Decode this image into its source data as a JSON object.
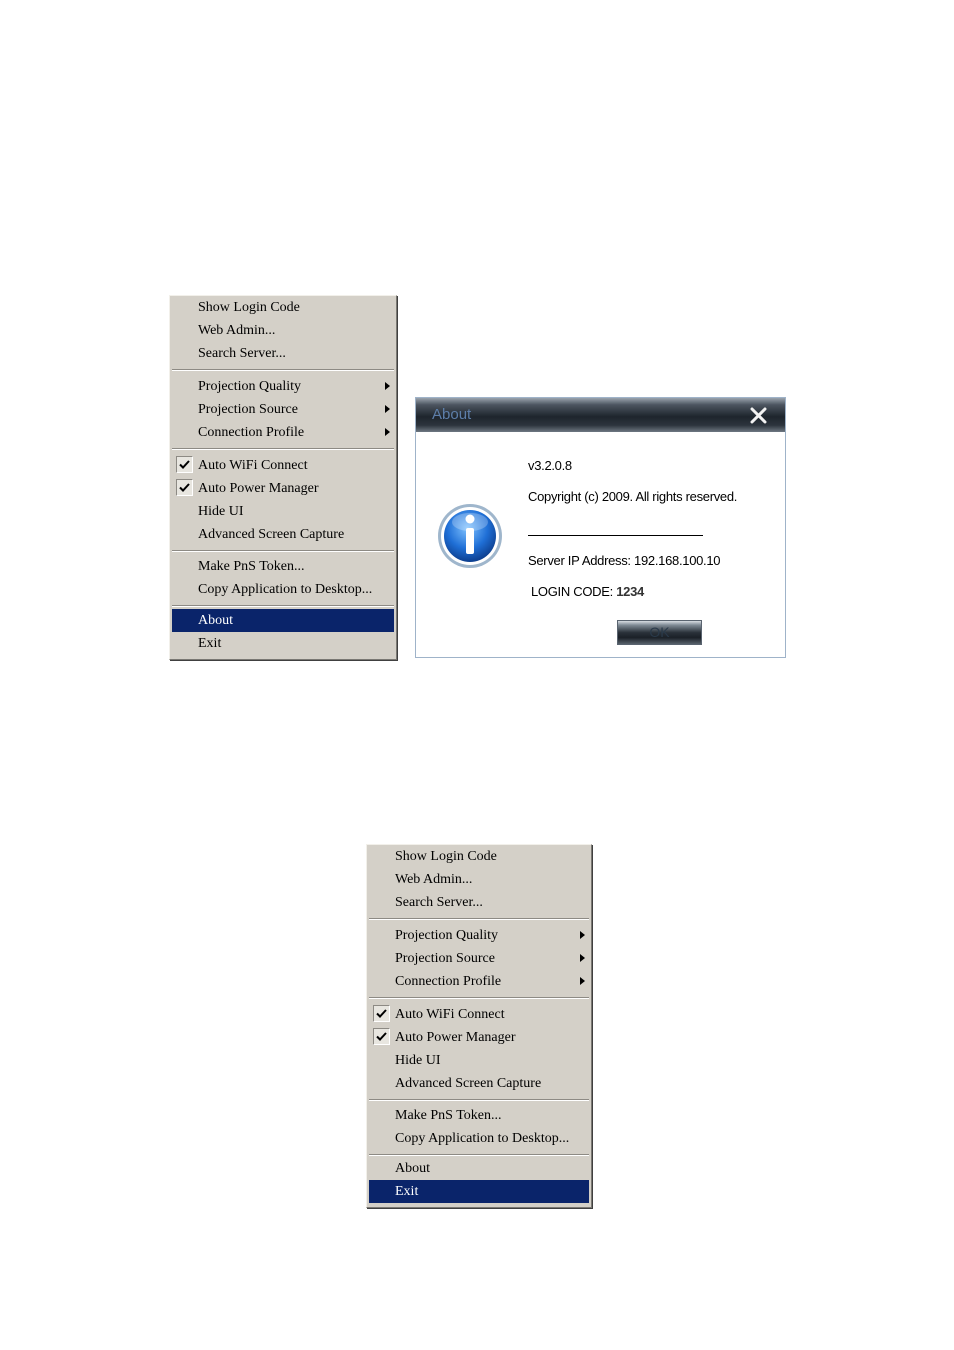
{
  "menu_top": {
    "items": [
      {
        "label": "Show Login Code"
      },
      {
        "label": "Web Admin..."
      },
      {
        "label": "Search Server..."
      },
      {
        "label": "Projection Quality"
      },
      {
        "label": "Projection Source"
      },
      {
        "label": "Connection Profile"
      },
      {
        "label": "Auto WiFi Connect",
        "checked": true
      },
      {
        "label": "Auto Power Manager",
        "checked": true
      },
      {
        "label": "Hide UI"
      },
      {
        "label": "Advanced Screen Capture"
      },
      {
        "label": "Make PnS Token..."
      },
      {
        "label": "Copy Application to Desktop..."
      },
      {
        "label": "About",
        "highlighted": true
      },
      {
        "label": "Exit"
      }
    ]
  },
  "about_dialog": {
    "title": "About",
    "version": "v3.2.0.8",
    "copyright": "Copyright (c) 2009. All rights reserved.",
    "server_ip": "Server IP Address: 192.168.100.10",
    "login_code_label": "LOGIN CODE: ",
    "login_code_value": "1234",
    "ok_label": "OK"
  },
  "menu_bottom": {
    "items": [
      {
        "label": "Show Login Code"
      },
      {
        "label": "Web Admin..."
      },
      {
        "label": "Search Server..."
      },
      {
        "label": "Projection Quality"
      },
      {
        "label": "Projection Source"
      },
      {
        "label": "Connection Profile"
      },
      {
        "label": "Auto WiFi Connect",
        "checked": true
      },
      {
        "label": "Auto Power Manager",
        "checked": true
      },
      {
        "label": "Hide UI"
      },
      {
        "label": "Advanced Screen Capture"
      },
      {
        "label": "Make PnS Token..."
      },
      {
        "label": "Copy Application to Desktop..."
      },
      {
        "label": "About"
      },
      {
        "label": "Exit",
        "highlighted": true
      }
    ]
  },
  "colors": {
    "menu_background": "#d4d0c8",
    "highlight": "#0a246a",
    "highlight_text": "#ffffff",
    "dialog_title_text": "#5d7ea9"
  }
}
